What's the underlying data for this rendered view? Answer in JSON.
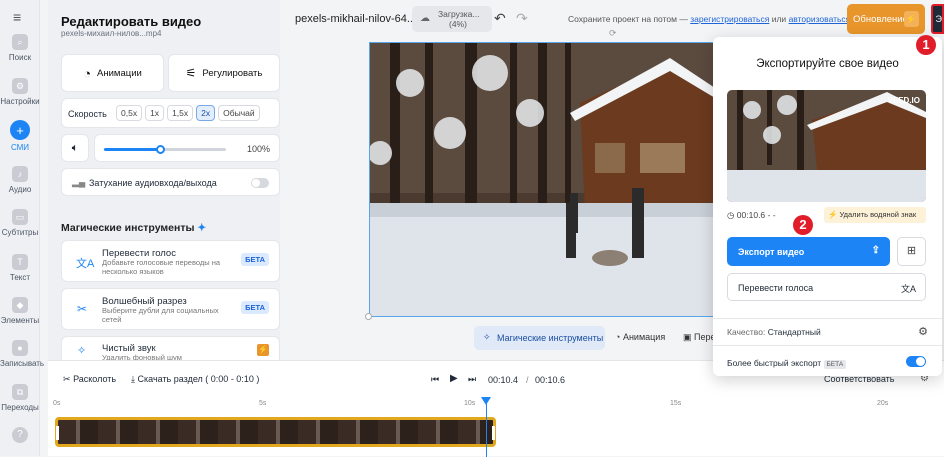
{
  "rail": {
    "items": [
      {
        "label": "Поиск",
        "icon": "search-icon"
      },
      {
        "label": "Настройки",
        "icon": "gear-icon"
      },
      {
        "label": "СМИ",
        "icon": "plus-icon"
      },
      {
        "label": "Аудио",
        "icon": "music-icon"
      },
      {
        "label": "Субтитры",
        "icon": "subtitles-icon"
      },
      {
        "label": "Текст",
        "icon": "text-icon"
      },
      {
        "label": "Элементы",
        "icon": "elements-icon"
      },
      {
        "label": "Записывать",
        "icon": "record-icon"
      },
      {
        "label": "Переходы",
        "icon": "transitions-icon"
      }
    ]
  },
  "panel": {
    "title": "Редактировать видео",
    "filename": "pexels-михаил-нилов...mp4",
    "animations": "Анимации",
    "adjust": "Регулировать",
    "speed_label": "Скорость",
    "speeds": [
      "0,5x",
      "1x",
      "1,5x",
      "2x",
      "Обычай"
    ],
    "volume": "100%",
    "fade_label": "Затухание аудиовхода/выхода",
    "magic_title": "Магические инструменты",
    "tools": [
      {
        "title": "Перевести голос",
        "desc": "Добавьте голосовые переводы на несколько языков",
        "badge": "БЕТА"
      },
      {
        "title": "Волшебный разрез",
        "desc": "Выберите дубли для социальных сетей",
        "badge": "БЕТА"
      },
      {
        "title": "Чистый звук",
        "desc": "Удалить фоновый шум",
        "badge": "⚡"
      }
    ]
  },
  "topbar": {
    "project": "pexels-mikhail-nilov-64...",
    "upload": "Загрузка...",
    "upload_pct": "(4%)",
    "save_prompt": "Сохраните проект на потом —",
    "register": "зарегистрироваться",
    "or": "или",
    "login": "авторизоваться",
    "upgrade": "Обновление",
    "export_short": "Э"
  },
  "canvas_toolbar": {
    "magic": "Магические инструменты",
    "animation": "Анимация",
    "more": "Пере"
  },
  "timeline": {
    "split": "Расколоть",
    "download": "Скачать раздел ( 0:00 - 0:10 )",
    "current": "00:10.4",
    "sep": "/",
    "total": "00:10.6",
    "fit": "Соответствовать",
    "ticks": [
      "0s",
      "5s",
      "10s",
      "15s",
      "20s"
    ]
  },
  "export": {
    "title": "Экспортируйте свое видео",
    "watermark": "VEED.IO",
    "duration": "00:10.6 - -",
    "remove_wm": "Удалить водяной знак",
    "export_btn": "Экспорт видео",
    "translate": "Перевести голоса",
    "quality_label": "Качество:",
    "quality_value": "Стандартный",
    "faster": "Более быстрый экспорт",
    "faster_badge": "БЕТА",
    "faster_on": true
  },
  "annotations": [
    "1",
    "2"
  ],
  "colors": {
    "accent": "#1d84f5",
    "upgrade": "#e8952b",
    "annotation": "#e11d2a"
  }
}
